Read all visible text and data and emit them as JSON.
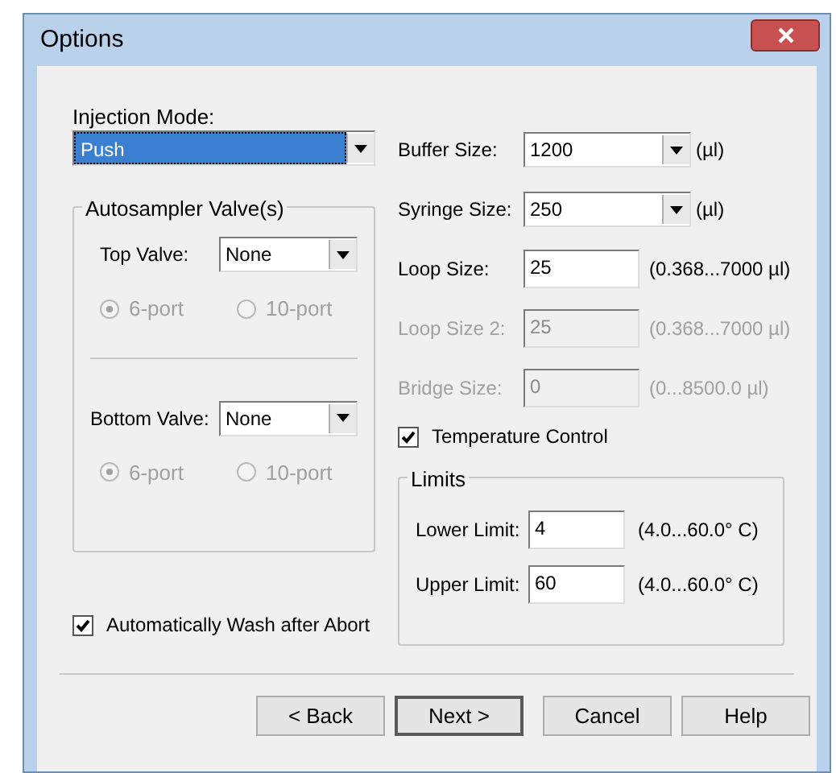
{
  "window": {
    "title": "Options"
  },
  "injection_mode": {
    "label": "Injection Mode:",
    "value": "Push",
    "focused": true
  },
  "valve_group": {
    "title": "Autosampler Valve(s)",
    "valves": [
      {
        "label": "Top Valve:",
        "value": "None",
        "ports": [
          {
            "label": "6-port",
            "selected": true,
            "disabled": true
          },
          {
            "label": "10-port",
            "selected": false,
            "disabled": true
          }
        ]
      },
      {
        "label": "Bottom Valve:",
        "value": "None",
        "ports": [
          {
            "label": "6-port",
            "selected": true,
            "disabled": true
          },
          {
            "label": "10-port",
            "selected": false,
            "disabled": true
          }
        ]
      }
    ]
  },
  "auto_wash": {
    "label": "Automatically Wash after Abort",
    "checked": true
  },
  "sizes": [
    {
      "kind": "dropdown",
      "label": "Buffer Size:",
      "value": "1200",
      "unit": "(µl)",
      "disabled": false
    },
    {
      "kind": "dropdown",
      "label": "Syringe Size:",
      "value": "250",
      "unit": "(µl)",
      "disabled": false
    },
    {
      "kind": "text",
      "label": "Loop Size:",
      "value": "25",
      "unit": "(0.368...7000 µl)",
      "disabled": false
    },
    {
      "kind": "text",
      "label": "Loop Size 2:",
      "value": "25",
      "unit": "(0.368...7000 µl)",
      "disabled": true
    },
    {
      "kind": "text",
      "label": "Bridge Size:",
      "value": "0",
      "unit": "(0...8500.0 µl)",
      "disabled": true
    }
  ],
  "temperature_control": {
    "label": "Temperature Control",
    "checked": true
  },
  "limits": {
    "title": "Limits",
    "rows": [
      {
        "label": "Lower Limit:",
        "value": "4",
        "range": "(4.0...60.0° C)"
      },
      {
        "label": "Upper Limit:",
        "value": "60",
        "range": "(4.0...60.0° C)"
      }
    ]
  },
  "buttons": [
    {
      "label": "< Back",
      "default": false
    },
    {
      "label": "Next >",
      "default": true
    },
    {
      "label": "Cancel",
      "default": false
    },
    {
      "label": "Help",
      "default": false
    }
  ]
}
